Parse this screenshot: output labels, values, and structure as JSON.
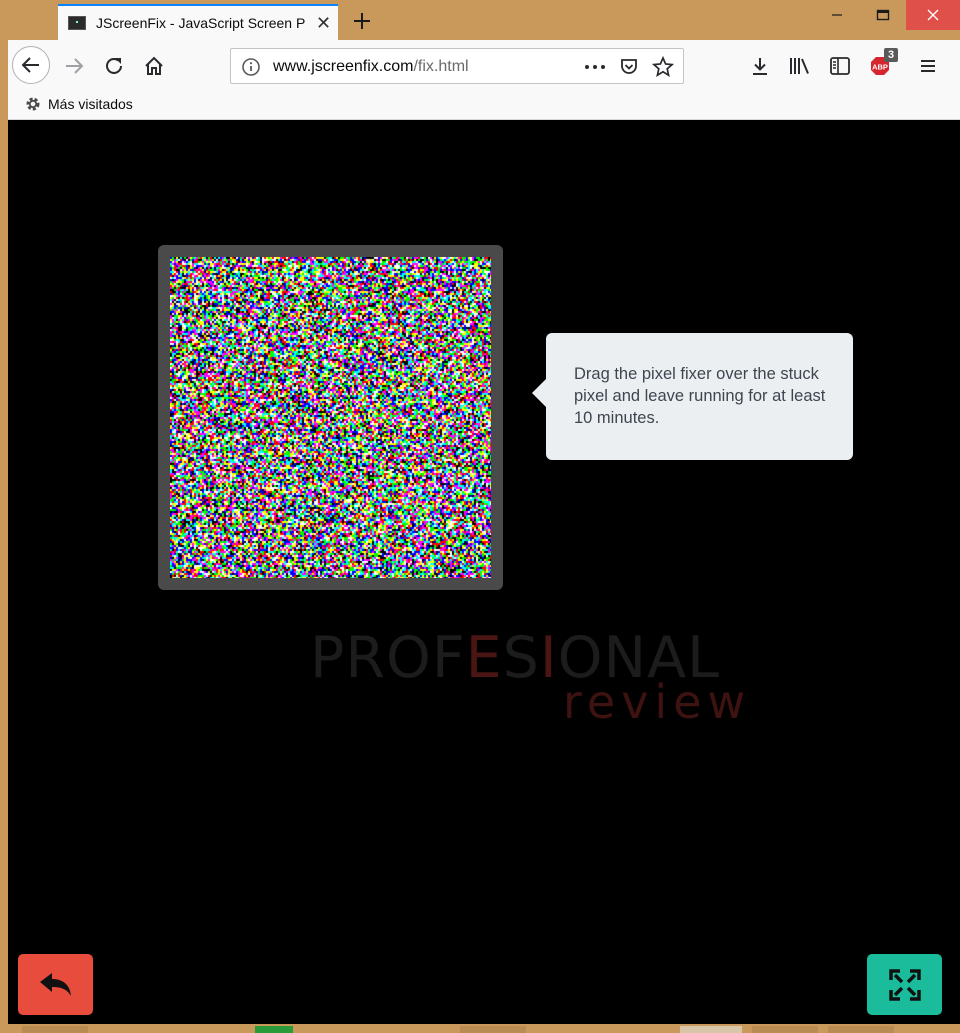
{
  "browser": {
    "tab_title": "JScreenFix - JavaScript Screen P",
    "url": "www.jscreenfix.com/fix.html",
    "url_domain": "www.jscreenfix.com",
    "url_path": "/fix.html",
    "adblock_badge": "3",
    "bookmark_label": "Más visitados"
  },
  "page": {
    "tooltip_text": "Drag the pixel fixer over the stuck pixel and leave running for at least 10 minutes.",
    "watermark_line1_a": "PROF",
    "watermark_line1_b": "E",
    "watermark_line1_c": "S",
    "watermark_line1_d": "I",
    "watermark_line1_e": "ONAL",
    "watermark_line2": "review"
  },
  "colors": {
    "back_button": "#e74c3c",
    "fullscreen_button": "#1abc9c",
    "tooltip_bg": "#eceff1",
    "fixer_frame": "#4a4a4a"
  }
}
